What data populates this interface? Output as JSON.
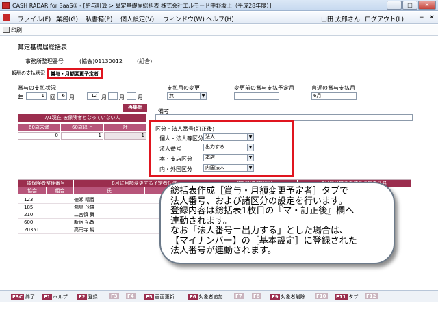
{
  "window": {
    "title": "CASH RADAR for SaaS② - [給与計算 > 算定基礎届総括表 株式会社エルモード中野坂上（平成28年度）]",
    "min": "−",
    "max": "□",
    "close": "✕"
  },
  "menu": {
    "items": [
      "ファイル(F)",
      "業務(G)",
      "私書箱(P)",
      "個人設定(V)",
      "ウィンドウ(W)",
      "ヘルプ(H)"
    ],
    "user": "山田 太郎さん",
    "logout": "ログアウト(L)",
    "restore": "−",
    "close": "✕"
  },
  "toolbar": {
    "print": "印刷"
  },
  "form": {
    "title": "算定基礎届総括表",
    "office_label": "事務所整理番号",
    "office_code": "(協会)01130012",
    "union": "(組合)"
  },
  "tabs": [
    "報酬の支払状況",
    "賞与・月額変更予定者"
  ],
  "bonus": {
    "label": "賞与の支払状況",
    "year_label": "年",
    "times": "1",
    "times_unit": "回",
    "months": [
      "6",
      "12",
      "",
      ""
    ],
    "month_unit": "月"
  },
  "pay_change": {
    "label": "支払月の変更",
    "value": "無"
  },
  "before_change": {
    "label": "変更前の賞与支払予定月"
  },
  "recent": {
    "label": "直近の賞与支払月",
    "value": "6月"
  },
  "recalc": "再集計",
  "remarks_label": "備考",
  "insured": {
    "header": "7/1現在 被保険者となっていない人",
    "cols": [
      "60歳未満",
      "60歳以上",
      "計"
    ],
    "values": [
      "0",
      "1",
      "1"
    ]
  },
  "kubun": {
    "title": "区分・法人番号(訂正後)",
    "rows": [
      {
        "label": "個人・法人等区分",
        "value": "法人"
      },
      {
        "label": "法人番号",
        "value": "出力する"
      },
      {
        "label": "本・支店区分",
        "value": "本店"
      },
      {
        "label": "内・外国区分",
        "value": "内国法人"
      }
    ]
  },
  "table": {
    "head1": "被保険者整理番号",
    "head2": "8月に月額変更する予定者氏名",
    "sub": [
      "協会",
      "組合",
      "氏",
      "名"
    ],
    "head3": "被保険者整理番号",
    "head4": "8月に月額変更する予定者氏名",
    "rows": [
      {
        "no": "123",
        "name": "徳瀬 晴香"
      },
      {
        "no": "185",
        "name": "鴻島 茂雄"
      },
      {
        "no": "210",
        "name": "二宮慎 舞"
      },
      {
        "no": "600",
        "name": "新宿 拓哉"
      },
      {
        "no": "20351",
        "name": "高円寺 純"
      }
    ]
  },
  "bubble": [
    "総括表作成［賞与・月額変更予定者］タブで",
    "法人番号、および諸区分の設定を行います。",
    "登録内容は総括表1枚目の『マ・訂正後』欄へ",
    "連動されます。",
    "なお「法人番号＝出力する」とした場合は、",
    "【マイナンバー】の［基本設定］に登録された",
    "法人番号が連動されます。"
  ],
  "fkeys": [
    {
      "k": "ESC",
      "l": "終了"
    },
    {
      "k": "F1",
      "l": "ヘルプ"
    },
    {
      "k": "F2",
      "l": "登録"
    },
    {
      "k": "F3",
      "l": ""
    },
    {
      "k": "F4",
      "l": ""
    },
    {
      "k": "F5",
      "l": "画面更新"
    },
    {
      "k": "F6",
      "l": "対象者追加"
    },
    {
      "k": "F7",
      "l": ""
    },
    {
      "k": "F8",
      "l": ""
    },
    {
      "k": "F9",
      "l": "対象者削除"
    },
    {
      "k": "F10",
      "l": ""
    },
    {
      "k": "F11",
      "l": "タブ"
    },
    {
      "k": "F12",
      "l": ""
    }
  ],
  "colors": {
    "accent": "#9b2e4e",
    "highlight": "#e0151f"
  }
}
